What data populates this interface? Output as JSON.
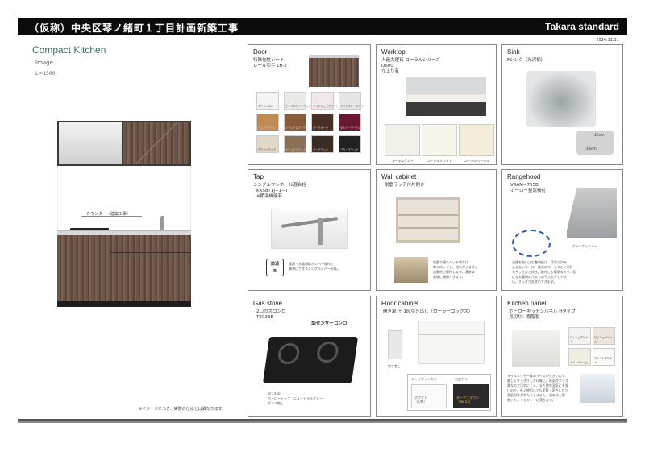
{
  "header": {
    "title": "（仮称）中央区琴ノ緒町１丁目計画新築工事",
    "brand": "Takara standard",
    "date": "2024.11.11"
  },
  "left": {
    "title": "Compact Kitchen",
    "subtitle": "Image",
    "size": "L＝1500",
    "counter_label": "カウンター（建築工事）",
    "note": "※イメージにつき、実際の仕様とは異なります。"
  },
  "door": {
    "heading": "Door",
    "spec1": "特殊化粧シート",
    "spec2": "レール引手 LH-2",
    "swatches": [
      {
        "label": "ホワイトUN",
        "color": "#f4f4f2"
      },
      {
        "label": "クールホワイトウッド",
        "color": "#eaeae6"
      },
      {
        "label": "クリアピンクホワイト",
        "color": "#f0e8ea"
      },
      {
        "label": "クリアグレーホワイト",
        "color": "#e6e6e8"
      },
      {
        "label": "ウッドブラウン",
        "color": "#c08a55"
      },
      {
        "label": "ミディアムブラウン",
        "color": "#8a5b38"
      },
      {
        "label": "ダークオーク",
        "color": "#4a3024"
      },
      {
        "label": "ボルドーダークレッド",
        "color": "#6a1830"
      },
      {
        "label": "ホワイトウッド",
        "color": "#e2d8c8"
      },
      {
        "label": "ナチュラルウッド",
        "color": "#8c7055"
      },
      {
        "label": "ダークウッド",
        "color": "#3b2c24"
      },
      {
        "label": "ブラックウッド",
        "color": "#222222"
      }
    ]
  },
  "worktop": {
    "heading": "Worktop",
    "spec1": "人造大理石 コーラルシリーズ",
    "spec2": "D600",
    "spec3": "立上り有",
    "colors": [
      {
        "label": "コーラルグレー",
        "color": "#f1f1ea"
      },
      {
        "label": "コーラルホワイト",
        "color": "#f7f5ec"
      },
      {
        "label": "コーラルベージュ",
        "color": "#f4eddb"
      }
    ]
  },
  "sink": {
    "heading": "Sink",
    "spec1": "Fシンク（光沢柄）",
    "dim1": "42cm",
    "dim2": "48cm"
  },
  "tap": {
    "heading": "Tap",
    "spec1": "シングルワンホール混合栓",
    "spec2": "KXS871J−1−T",
    "spec3": "※節湯機能有",
    "badge1": "節湯",
    "badge2": "B",
    "desc1": "温調・水量調節がレバー操作で",
    "desc2": "簡単にできるシングルレバー水栓。"
  },
  "wall_cabinet": {
    "heading": "Wall cabinet",
    "spec1": "耐震ラッチ付片開き",
    "desc1": "地震で揺れている時だけ",
    "desc2": "扉をロックし、揺れが止まると",
    "desc3": "自動的に解除します。通常は",
    "desc4": "普通に開閉できます。"
  },
  "rangehood": {
    "heading": "Rangehood",
    "spec1": "VRAM−753B",
    "spec2": "ホーロー整流板付",
    "label": "プラチナシルバー",
    "desc1": "油煙を吸い込む整流板は、汚れの染み",
    "desc2": "込まないホーロー製なので、しつこい汚れ",
    "desc3": "もサッとひと拭き。取外しも簡単なので、気",
    "desc4": "になる裏側の汚れもお手入れがしやす",
    "desc5": "い。すっきり丸洗いできます。"
  },
  "gas_stove": {
    "heading": "Gas stove",
    "spec1": "2口ガスコンロ",
    "spec2": "T202EB",
    "logo": "Siセンサーコンロ",
    "spec3": "W＝450",
    "spec4": "ホーロートップ（ニュートラルグレー）",
    "spec5": "グリル無し"
  },
  "floor_cabinet": {
    "heading": "Floor cabinet",
    "spec1": "開き扉 ＋ 1段引き出し（ローラーコックス）",
    "knife": "包丁差し",
    "col1": "キャビネットカラー",
    "col2": "台座カラー",
    "c1": "ホワイト",
    "c1b": "（T/M）",
    "c2": "ダークブラウン",
    "c2b": "（No.53）"
  },
  "kitchen_panel": {
    "heading": "Kitchen panel",
    "spec1": "ホーローキッチンパネル Hタイプ",
    "spec2": "見切り：樹脂製",
    "tiles": [
      {
        "label": "ロッシュホワイト",
        "color": "#f4f2f0"
      },
      {
        "label": "ロッシュベージュ",
        "color": "#ece4da"
      },
      {
        "label": "ライトベージュ",
        "color": "#f2ede2"
      },
      {
        "label": "マイルドホワイト",
        "color": "#fbfaf6"
      }
    ],
    "desc1": "タイルよりも一枚のサイズが大きいので、",
    "desc2": "美しくすっきりした印象に。表面がガラス",
    "desc3": "質なので汚れにくく、また熱や湿気にも強",
    "desc4": "いので、長く使用しても変質・変色したり",
    "desc5": "表面がはがれたりしません。波を拭く際",
    "desc6": "乾いたシミもキレイに落ちます。"
  },
  "colors": {
    "header_bg": "#0b0b0b",
    "title_accent": "#3a6b6b",
    "panel_border": "#8a8a8a"
  }
}
